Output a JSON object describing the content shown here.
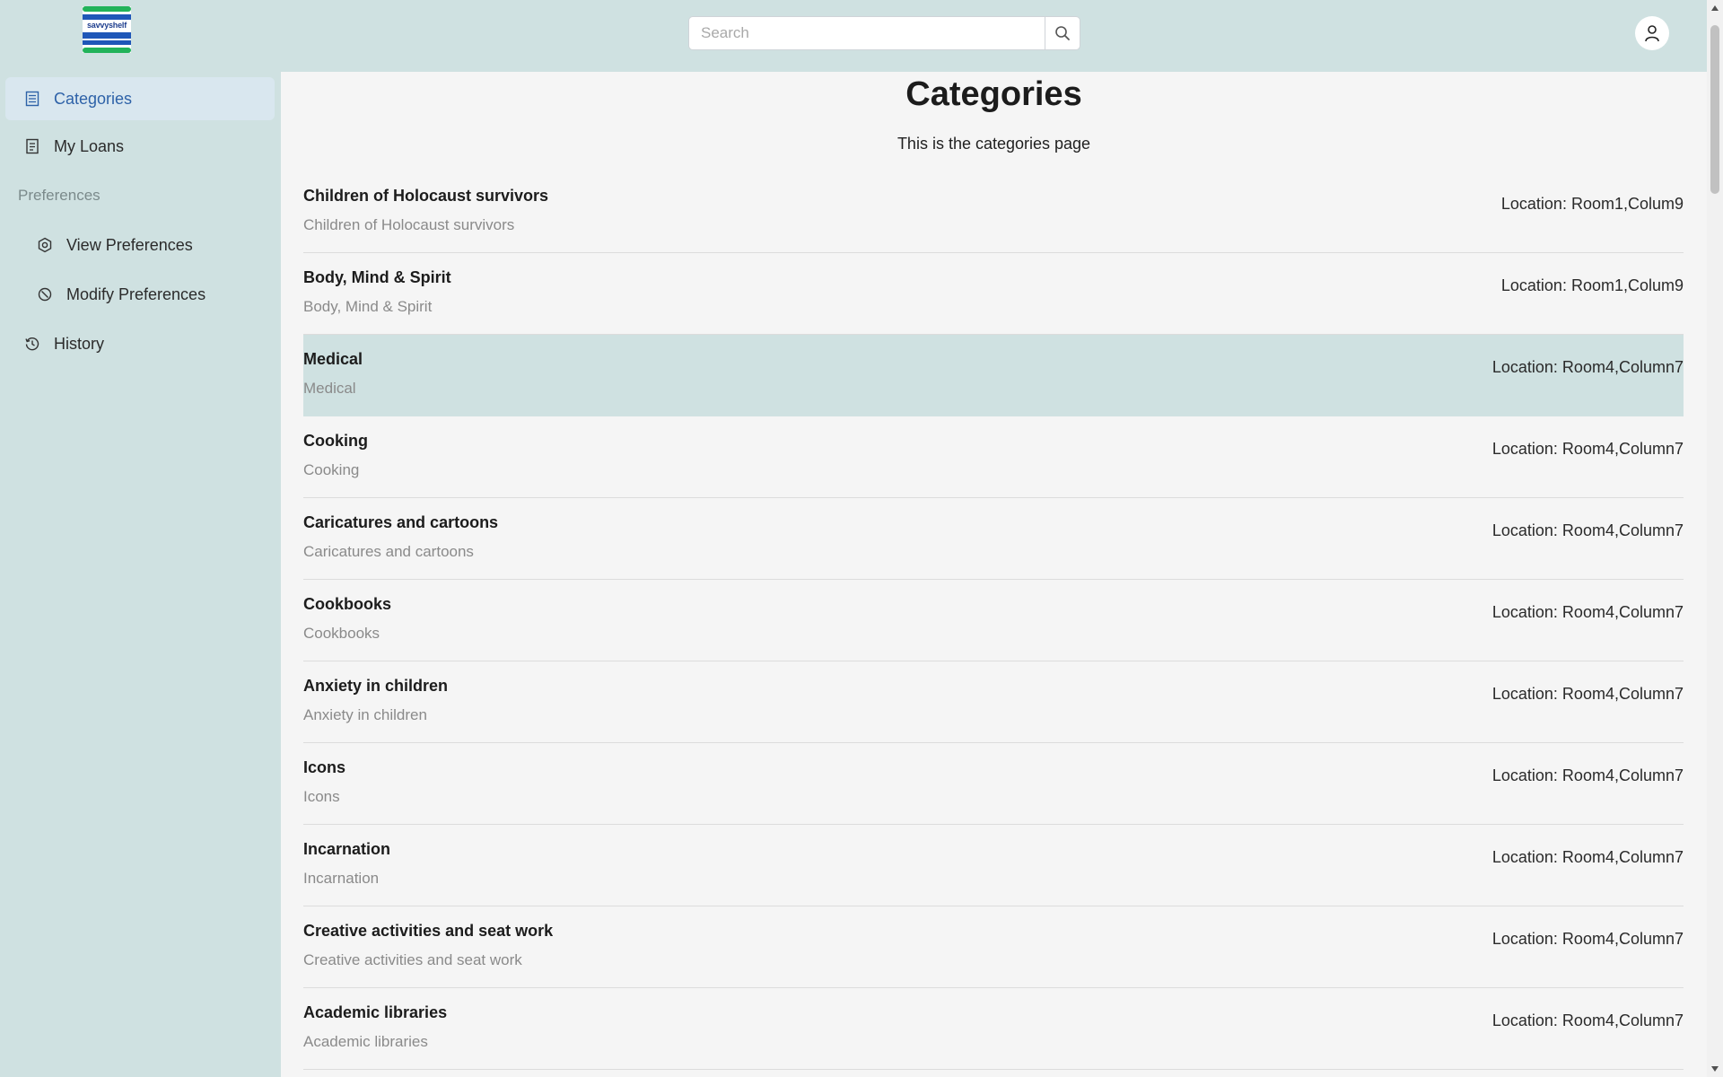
{
  "header": {
    "logo_text": "savvyshelf",
    "search": {
      "placeholder": "Search",
      "value": ""
    }
  },
  "sidebar": {
    "items": [
      {
        "label": "Categories",
        "icon": "list-icon",
        "active": true
      },
      {
        "label": "My Loans",
        "icon": "document-icon"
      }
    ],
    "preferences_label": "Preferences",
    "preference_items": [
      {
        "label": "View Preferences",
        "icon": "settings-icon"
      },
      {
        "label": "Modify Preferences",
        "icon": "edit-settings-icon"
      }
    ],
    "history": {
      "label": "History",
      "icon": "history-icon"
    }
  },
  "main": {
    "title": "Categories",
    "subtitle": "This is the categories page",
    "categories": [
      {
        "name": "Children of Holocaust survivors",
        "description": "Children of Holocaust survivors",
        "location": "Location: Room1,Colum9"
      },
      {
        "name": "Body, Mind & Spirit",
        "description": "Body, Mind & Spirit",
        "location": "Location: Room1,Colum9"
      },
      {
        "name": "Medical",
        "description": "Medical",
        "location": "Location: Room4,Column7",
        "highlighted": true
      },
      {
        "name": "Cooking",
        "description": "Cooking",
        "location": "Location: Room4,Column7"
      },
      {
        "name": "Caricatures and cartoons",
        "description": "Caricatures and cartoons",
        "location": "Location: Room4,Column7"
      },
      {
        "name": "Cookbooks",
        "description": "Cookbooks",
        "location": "Location: Room4,Column7"
      },
      {
        "name": "Anxiety in children",
        "description": "Anxiety in children",
        "location": "Location: Room4,Column7"
      },
      {
        "name": "Icons",
        "description": "Icons",
        "location": "Location: Room4,Column7"
      },
      {
        "name": "Incarnation",
        "description": "Incarnation",
        "location": "Location: Room4,Column7"
      },
      {
        "name": "Creative activities and seat work",
        "description": "Creative activities and seat work",
        "location": "Location: Room4,Column7"
      },
      {
        "name": "Academic libraries",
        "description": "Academic libraries",
        "location": "Location: Room4,Column7"
      }
    ]
  },
  "colors": {
    "header_bg": "#cfe1e1",
    "sidebar_bg": "#cfe1e1",
    "active_item_bg": "#d9e7ef",
    "active_item_text": "#2e62a8",
    "highlight_row_bg": "#cfe1e1",
    "main_bg": "#f5f5f5"
  }
}
